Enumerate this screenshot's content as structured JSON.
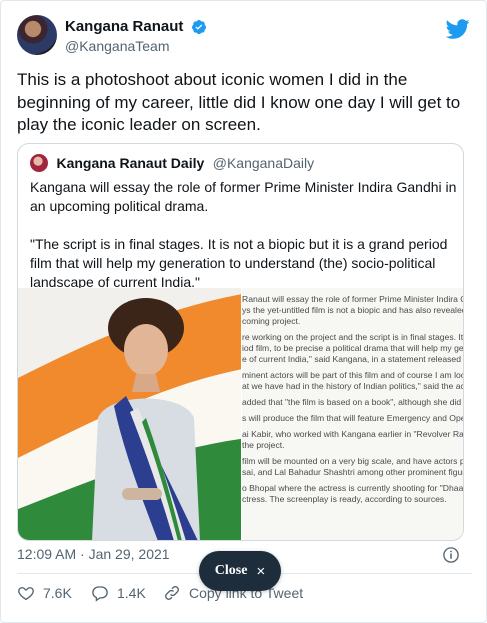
{
  "author": {
    "display_name": "Kangana Ranaut",
    "handle": "@KanganaTeam"
  },
  "tweet_text": "This is a photoshoot about iconic women I did in the beginning of my career, little did I know one day I will get to play the iconic leader on screen.",
  "quoted": {
    "display_name": "Kangana Ranaut Daily",
    "handle": "@KanganaDaily",
    "paragraph_1": "Kangana will essay the role of former Prime Minister Indira Gandhi in an upcoming political drama.",
    "paragraph_2": "\"The script is in final stages. It is not a biopic but it is a grand period film that will help my generation to understand (the) socio-political landscape of current India.\"",
    "article_lines": [
      "Ranaut will essay the role of former Prime Minister Indira Gandhi",
      "ys the yet-untitled film is not a biopic and has also revealed th",
      "coming project.",
      "",
      "re working on the project and the script is in final stages. It is n",
      "iod film, to be precise a political drama that will help my genera",
      "e of current India,\" said Kangana, in a statement released by her",
      "",
      "minent actors will be part of this film and of course I am lookin",
      "at we have had in the history of Indian politics,\" said the actress",
      "",
      "added that \"the film is based on a book\", although she did not e",
      "",
      "s will produce the film that will feature Emergency and Operati",
      "",
      "ai Kabir, who worked with Kangana earlier in \"Revolver Rani\" w",
      "the project.",
      "",
      "film will be mounted on a very big scale, and have actors port",
      "sai, and Lal Bahadur Shashtri among other prominent figures.",
      "",
      "o Bhopal where the actress is currently shooting for \"Dhaakad",
      "ctress. The screenplay is ready, according to sources."
    ]
  },
  "timestamp": "12:09 AM · Jan 29, 2021",
  "actions": {
    "likes": "7.6K",
    "replies": "1.4K",
    "copy_link": "Copy link to Tweet"
  },
  "overlay": {
    "close_label": "Close",
    "close_symbol": "×"
  },
  "colors": {
    "twitter_blue": "#1d9bf0",
    "secondary_text": "#536471",
    "close_pill": "#1e2d3b"
  },
  "icons": [
    "verified-badge-icon",
    "twitter-bird-icon",
    "info-icon",
    "heart-icon",
    "reply-bubble-icon",
    "link-icon",
    "close-x-icon"
  ]
}
